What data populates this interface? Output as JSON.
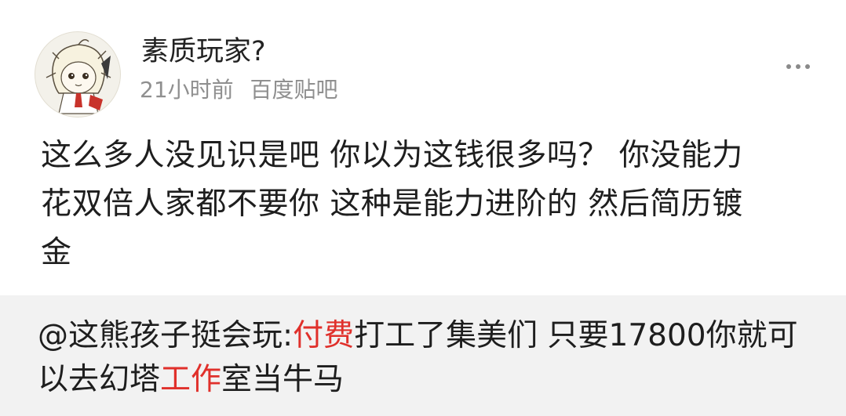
{
  "post": {
    "username": "素质玩家?",
    "time": "21小时前",
    "source": "百度贴吧",
    "body_lines": [
      "这么多人没见识是吧 你以为这钱很多吗？ 你没能力",
      "花双倍人家都不要你 这种是能力进阶的 然后简历镀",
      "金"
    ]
  },
  "quote": {
    "mention": "@这熊孩子挺会玩:",
    "seg1_red": "付费",
    "seg2": "打工了集美们 只要17800你就可",
    "seg3": "以去幻塔",
    "seg4_red": "工作",
    "seg5": "室当牛马"
  },
  "colors": {
    "highlight": "#e0302b",
    "quote_bg": "#f2f2f2",
    "meta": "#8f8f8f"
  },
  "icons": {
    "avatar": "anime-girl-avatar",
    "more": "more-dots-icon"
  }
}
